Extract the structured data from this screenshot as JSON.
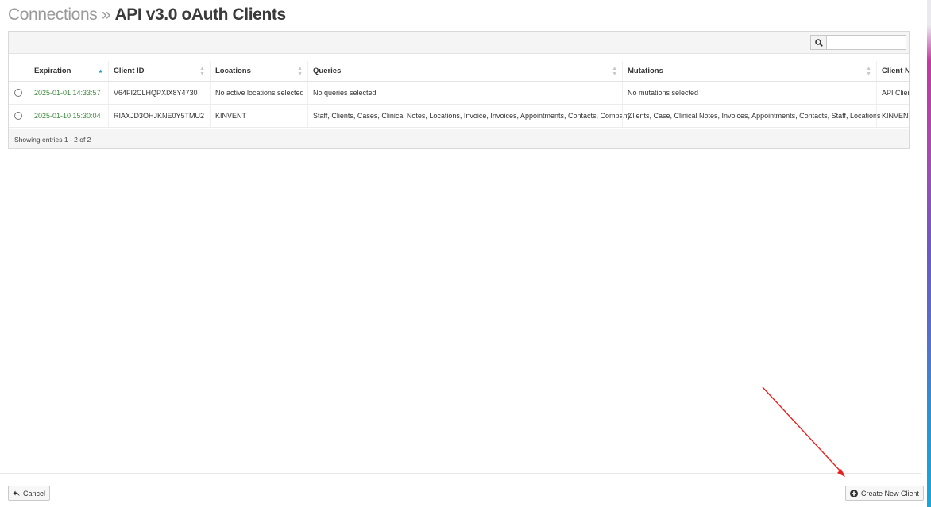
{
  "header": {
    "crumb": "Connections",
    "separator": "»",
    "title": "API v3.0 oAuth Clients"
  },
  "search": {
    "value": "",
    "placeholder": ""
  },
  "table": {
    "columns": [
      "Expiration",
      "Client ID",
      "Locations",
      "Queries",
      "Mutations",
      "Client Na"
    ],
    "rows": [
      {
        "expiration": "2025-01-01 14:33:57",
        "client_id": "V64FI2CLHQPXIX8Y4730",
        "locations": "No active locations selected",
        "queries": "No queries selected",
        "mutations": "No mutations selected",
        "client_name": "API Clien"
      },
      {
        "expiration": "2025-01-10 15:30:04",
        "client_id": "RIAXJD3OHJKNE0Y5TMU2",
        "locations": "KINVENT",
        "queries": "Staff, Clients, Cases, Clinical Notes, Locations, Invoice, Invoices, Appointments, Contacts, Company",
        "mutations": "Clients, Case, Clinical Notes, Invoices, Appointments, Contacts, Staff, Locations",
        "client_name": "KINVENT"
      }
    ],
    "info": "Showing entries 1 - 2 of 2"
  },
  "footer": {
    "cancel_label": "Cancel",
    "create_label": "Create New Client"
  },
  "colors": {
    "annotation_arrow": "#e8201c",
    "expiration_text": "#3d8a3d",
    "sort_active": "#2a9fd6"
  }
}
